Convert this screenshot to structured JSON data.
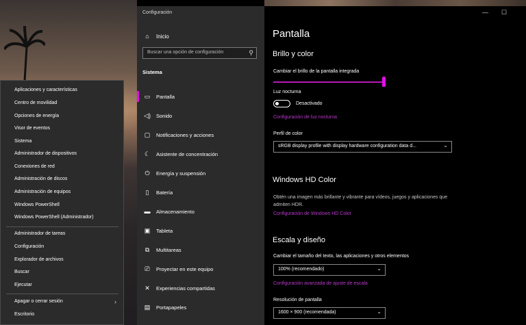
{
  "context_menu": {
    "items": [
      {
        "label": "Aplicaciones y características"
      },
      {
        "label": "Centro de movilidad"
      },
      {
        "label": "Opciones de energía"
      },
      {
        "label": "Visor de eventos"
      },
      {
        "label": "Sistema"
      },
      {
        "label": "Administrador de dispositivos"
      },
      {
        "label": "Conexiones de red"
      },
      {
        "label": "Administración de discos"
      },
      {
        "label": "Administración de equipos"
      },
      {
        "label": "Windows PowerShell"
      },
      {
        "label": "Windows PowerShell (Administrador)"
      },
      {
        "label": "Administrador de tareas"
      },
      {
        "label": "Configuración"
      },
      {
        "label": "Explorador de archivos"
      },
      {
        "label": "Buscar"
      },
      {
        "label": "Ejecutar"
      },
      {
        "label": "Apagar o cerrar sesión"
      },
      {
        "label": "Escritorio"
      }
    ],
    "submenu_icon": "chevron-right-icon"
  },
  "sidebar": {
    "app_title": "Configuración",
    "home_label": "Inicio",
    "search_placeholder": "Buscar una opción de configuración",
    "section": "Sistema",
    "items": [
      {
        "label": "Pantalla",
        "icon": "monitor-icon",
        "glyph": "▭"
      },
      {
        "label": "Sonido",
        "icon": "speaker-icon",
        "glyph": "◁)"
      },
      {
        "label": "Notificaciones y acciones",
        "icon": "notification-icon",
        "glyph": "▢"
      },
      {
        "label": "Asistente de concentración",
        "icon": "moon-icon",
        "glyph": "☾"
      },
      {
        "label": "Energía y suspensión",
        "icon": "power-icon",
        "glyph": "⏻"
      },
      {
        "label": "Batería",
        "icon": "battery-icon",
        "glyph": "▯"
      },
      {
        "label": "Almacenamiento",
        "icon": "storage-icon",
        "glyph": "▬"
      },
      {
        "label": "Tableta",
        "icon": "tablet-icon",
        "glyph": "▣"
      },
      {
        "label": "Multitareas",
        "icon": "multitasking-icon",
        "glyph": "⧉"
      },
      {
        "label": "Proyectar en este equipo",
        "icon": "projector-icon",
        "glyph": "⎚"
      },
      {
        "label": "Experiencias compartidas",
        "icon": "shared-icon",
        "glyph": "✕"
      },
      {
        "label": "Portapapeles",
        "icon": "clipboard-icon",
        "glyph": "▤"
      }
    ]
  },
  "main": {
    "title": "Pantalla",
    "brightness_section": "Brillo y color",
    "brightness_label": "Cambiar el brillo de la pantalla integrada",
    "night_light_label": "Luz nocturna",
    "night_light_state": "Desactivado",
    "night_light_link": "Configuración de luz nocturna",
    "color_profile_label": "Perfil de color",
    "color_profile_value": "sRGB display profile with display hardware configuration data d...",
    "hd_section": "Windows HD Color",
    "hd_desc": "Obtén una imagen más brillante y vibrante para vídeos, juegos y aplicaciones que admiten HDR.",
    "hd_link": "Configuración de Windows HD Color",
    "scale_section": "Escala y diseño",
    "scale_label": "Cambiar el tamaño del texto, las aplicaciones y otros elementos",
    "scale_value": "100% (recomendado)",
    "scale_link": "Configuración avanzada de ajuste de escala",
    "resolution_label": "Resolución de pantalla",
    "resolution_value": "1600 × 900 (recomendada)"
  },
  "window_controls": {
    "minimize": "—",
    "maximize": "☐"
  },
  "colors": {
    "accent": "#e20fe8",
    "link": "#b83ac9"
  }
}
